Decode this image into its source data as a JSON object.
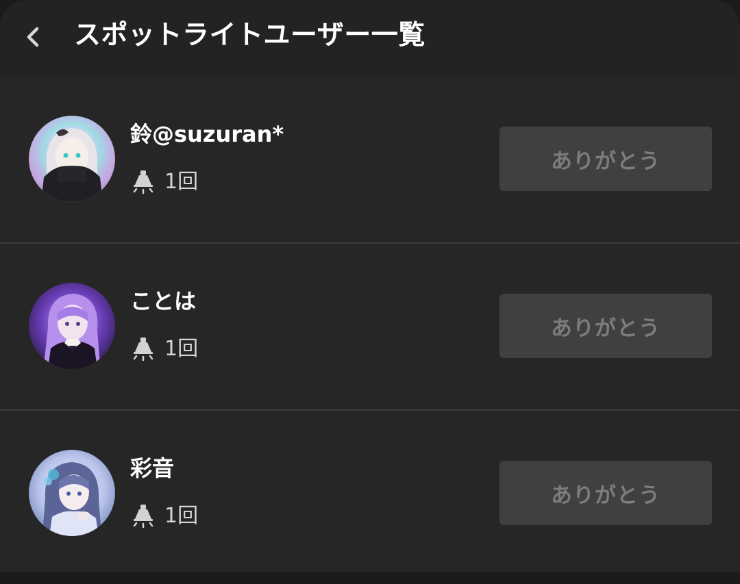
{
  "header": {
    "title": "スポットライトユーザー一覧",
    "back_icon": "chevron-left-icon"
  },
  "users": [
    {
      "name": "鈴@suzuran*",
      "count": "1回",
      "button_label": "ありがとう",
      "spotlight_icon": "spotlight-icon"
    },
    {
      "name": "ことは",
      "count": "1回",
      "button_label": "ありがとう",
      "spotlight_icon": "spotlight-icon"
    },
    {
      "name": "彩音",
      "count": "1回",
      "button_label": "ありがとう",
      "spotlight_icon": "spotlight-icon"
    }
  ],
  "colors": {
    "background": "#242424",
    "header": "#232323",
    "divider": "#3b3b3b",
    "button_bg": "#404040",
    "button_text": "#7c7c7c",
    "text": "#ffffff"
  }
}
